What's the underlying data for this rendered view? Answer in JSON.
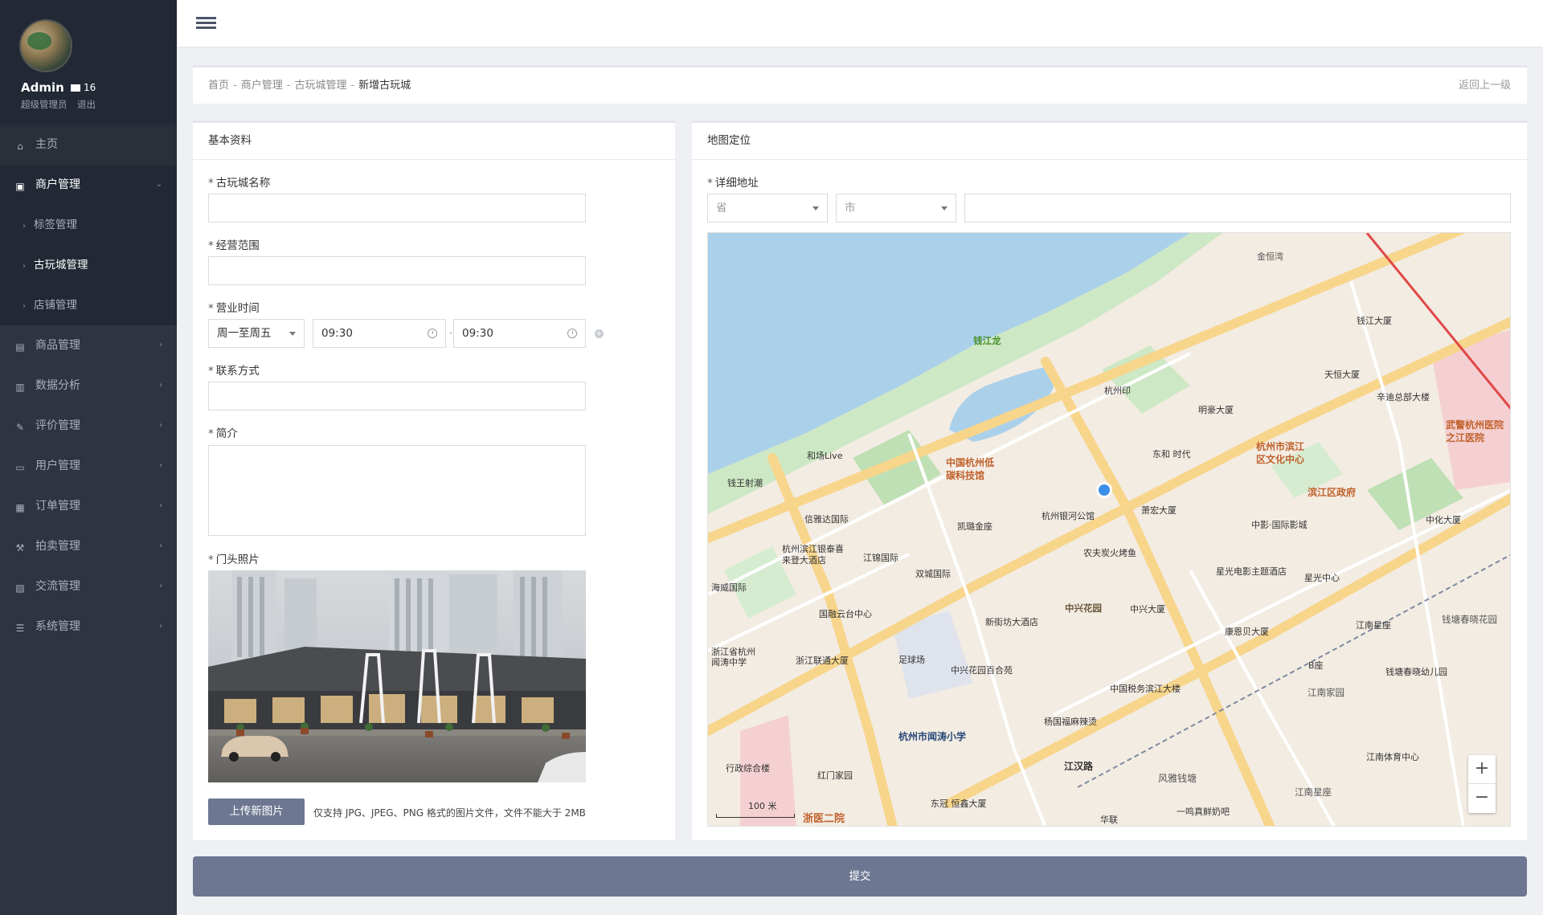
{
  "sidebar": {
    "user": {
      "name": "Admin",
      "mail_count": "16",
      "role": "超级管理员",
      "logout": "退出"
    },
    "home": "主页",
    "merchant": "商户管理",
    "sub": [
      "标签管理",
      "古玩城管理",
      "店铺管理"
    ],
    "items": [
      "商品管理",
      "数据分析",
      "评价管理",
      "用户管理",
      "订单管理",
      "拍卖管理",
      "交流管理",
      "系统管理"
    ]
  },
  "breadcrumb": {
    "home": "首页",
    "merchant": "商户管理",
    "mall": "古玩城管理",
    "current": "新增古玩城",
    "back": "返回上一级"
  },
  "basic": {
    "title": "基本资料",
    "name_label": "古玩城名称",
    "scope_label": "经营范围",
    "hours_label": "营业时间",
    "days": "周一至周五",
    "start": "09:30",
    "end": "09:30",
    "contact_label": "联系方式",
    "intro_label": "简介",
    "photo_label": "门头照片",
    "upload": "上传新图片",
    "upload_hint": "仅支持 JPG、JPEG、PNG 格式的图片文件，文件不能大于 2MB"
  },
  "map_panel": {
    "title": "地图定位",
    "address_label": "详细地址",
    "province": "省",
    "city": "市",
    "scale": "100 米",
    "labels": {
      "l1": "钱江龙",
      "l2": "中国杭州低碳科技馆",
      "l3": "杭州市滨江区文化中心",
      "l4": "滨江区政府",
      "l5": "武警杭州医院之江医院",
      "l6": "杭州印",
      "l7": "东和 时代",
      "l8": "明豪大厦",
      "l9": "钱江大厦",
      "l10": "天恒大厦",
      "l11": "辛迪总部大楼",
      "l12": "杭州银河公馆",
      "l13": "萧宏大厦",
      "l14": "中影·国际影城",
      "l15": "农夫炭火烤鱼",
      "l16": "星光电影主题酒店",
      "l17": "星光中心",
      "l18": "中兴花园",
      "l19": "中兴大厦",
      "l20": "国融云台中心",
      "l21": "新街坊大酒店",
      "l22": "双城国际",
      "l23": "江锦国际",
      "l24": "凯璐金座",
      "l25": "信雅达国际",
      "l26": "杭州滨江银泰喜来登大酒店",
      "l27": "海威国际",
      "l28": "浙江联通大厦",
      "l29": "足球场",
      "l30": "中兴花园百合苑",
      "l31": "中国税务滨江大楼",
      "l32": "杨国福麻辣烫",
      "l33": "杭州市闻涛小学",
      "l34": "江汉路",
      "l35": "风雅钱塘",
      "l36": "浙医二院",
      "l37": "江南家园",
      "l38": "B座",
      "l39": "康恩贝大厦",
      "l40": "江南星座",
      "l41": "钱塘春晓花园",
      "l42": "钱塘春晓幼儿园",
      "l43": "江南体育中心",
      "l44": "江南星座",
      "l45": "行政综合楼",
      "l46": "红门家园",
      "l47": "东冠 恒鑫大厦",
      "l48": "华联",
      "l49": "一鸣真鲜奶吧",
      "l50": "钱王射潮",
      "l51": "和场Live",
      "l52": "金恒湾",
      "l53": "中化大厦",
      "l54": "浙江省杭州闻涛中学"
    }
  },
  "submit": "提交"
}
